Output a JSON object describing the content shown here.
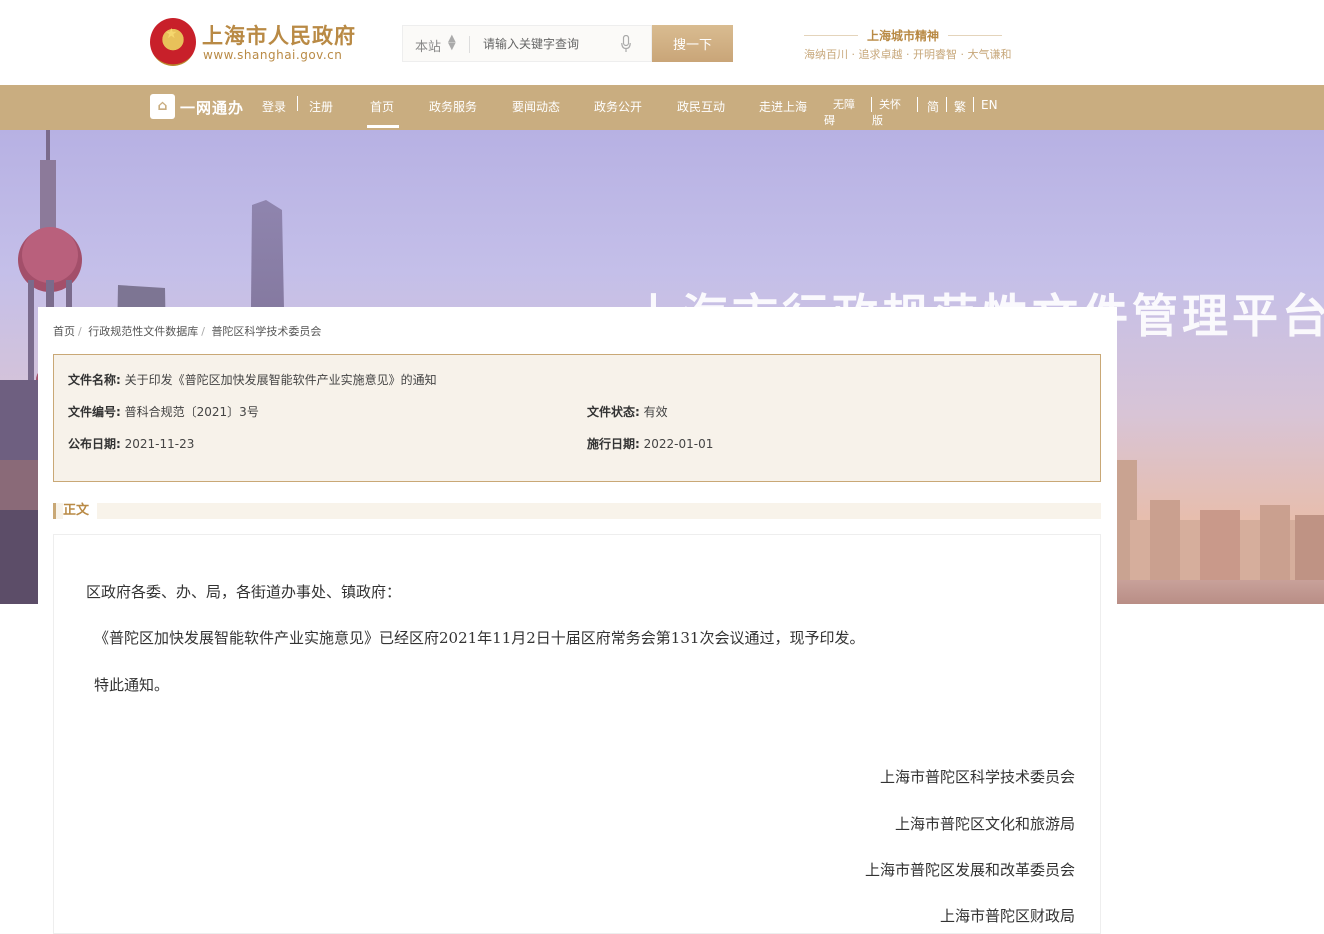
{
  "header": {
    "logo_title": "上海市人民政府",
    "logo_url": "www.shanghai.gov.cn",
    "search": {
      "scope": "本站",
      "placeholder": "请输入关键字查询",
      "button_label": "搜一下"
    },
    "spirit": {
      "title": "上海城市精神",
      "subtitle": "海纳百川 · 追求卓越 · 开明睿智 · 大气谦和"
    }
  },
  "nav": {
    "ywtb": "一网通办",
    "login": "登录",
    "register": "注册",
    "items": [
      "首页",
      "政务服务",
      "要闻动态",
      "政务公开",
      "政民互动",
      "走进上海"
    ],
    "accessibility_1": "无障",
    "accessibility_2": "碍",
    "care_1": "关怀",
    "care_2": "版",
    "simplified": "简",
    "traditional": "繁",
    "english": "EN"
  },
  "banner": {
    "title": "上海市行政规范性文件管理平台"
  },
  "breadcrumb": [
    "首页",
    "行政规范性文件数据库",
    "普陀区科学技术委员会"
  ],
  "meta": {
    "name_label": "文件名称:",
    "name_value": "关于印发《普陀区加快发展智能软件产业实施意见》的通知",
    "number_label": "文件编号:",
    "number_value": "普科合规范〔2021〕3号",
    "status_label": "文件状态:",
    "status_value": "有效",
    "publish_label": "公布日期:",
    "publish_value": "2021-11-23",
    "effective_label": "施行日期:",
    "effective_value": "2022-01-01"
  },
  "section": {
    "label": "正文"
  },
  "body": {
    "salutation": "区政府各委、办、局，各街道办事处、镇政府：",
    "paragraph": "《普陀区加快发展智能软件产业实施意见》已经区府2021年11月2日十届区府常务会第131次会议通过，现予印发。",
    "notice": "特此通知。",
    "signatures": [
      "上海市普陀区科学技术委员会",
      "上海市普陀区文化和旅游局",
      "上海市普陀区发展和改革委员会",
      "上海市普陀区财政局"
    ]
  },
  "colors": {
    "accent": "#c9ad80",
    "gold_text": "#b98a45"
  }
}
